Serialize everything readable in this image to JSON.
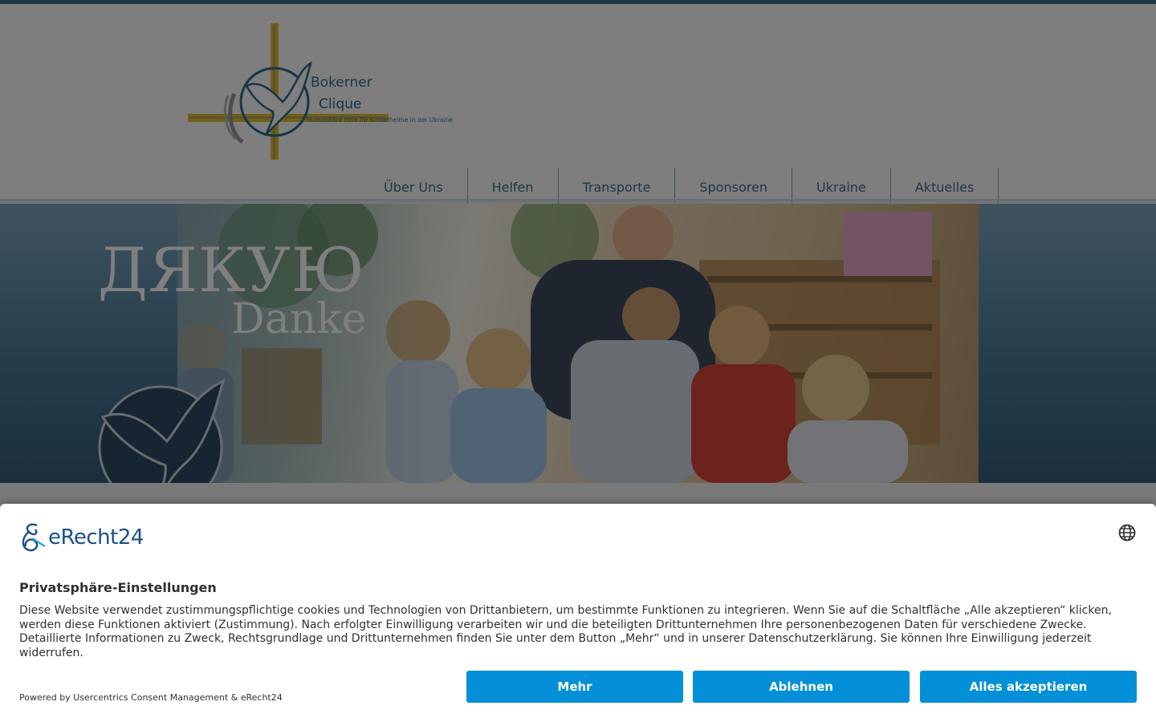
{
  "site": {
    "logo": {
      "line1": "Bokerner",
      "line2": "Clique",
      "tagline": "Humanitäre Hilfe für Kinderheime in der Ukraine"
    },
    "nav": [
      {
        "label": "Über Uns"
      },
      {
        "label": "Helfen"
      },
      {
        "label": "Transporte"
      },
      {
        "label": "Sponsoren"
      },
      {
        "label": "Ukraine"
      },
      {
        "label": "Aktuelles"
      }
    ],
    "banner": {
      "title_ua": "ДЯКУЮ",
      "title_de": "Danke"
    },
    "colors": {
      "nav_text": "#3c6f8f",
      "banner_blue": "#4d7b98",
      "logo_yellow": "#e2c12a"
    }
  },
  "consent": {
    "brand": "eRecht24",
    "title": "Privatsphäre-Einstellungen",
    "text": "Diese Website verwendet zustimmungspflichtige cookies und Technologien von Drittanbietern, um bestimmte Funktionen zu integrieren. Wenn Sie auf die Schaltfläche „Alle akzeptieren“ klicken, werden diese Funktionen aktiviert (Zustimmung). Nach erfolgter Einwilligung verarbeiten wir und die beteiligten Drittunternehmen Ihre personenbezogenen Daten für verschiedene Zwecke. Detaillierte Informationen zu Zweck, Rechtsgrundlage und Drittunternehmen finden Sie unter dem Button „Mehr“ und in unserer Datenschutzerklärung. Sie können Ihre Einwilligung jederzeit widerrufen.",
    "powered_by": "Powered by Usercentrics Consent Management & eRecht24",
    "buttons": {
      "more": "Mehr",
      "deny": "Ablehnen",
      "accept": "Alles akzeptieren"
    },
    "language_icon": "globe-icon",
    "button_color": "#0390d8"
  }
}
